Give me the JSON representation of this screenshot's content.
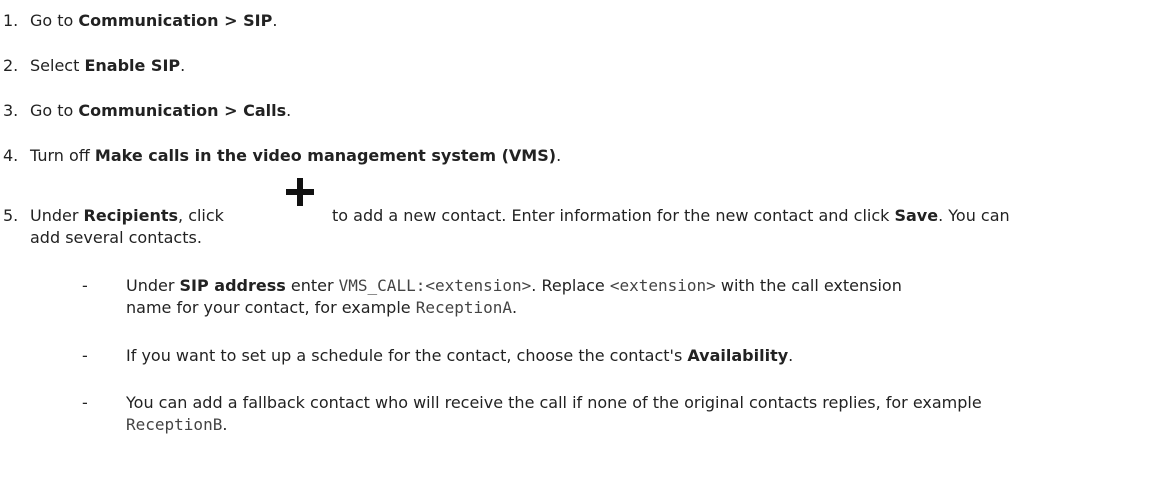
{
  "steps": [
    {
      "num": "1.",
      "pre": "Go to ",
      "b1": "Communication > SIP",
      "post": "."
    },
    {
      "num": "2.",
      "pre": "Select ",
      "b1": "Enable SIP",
      "post": "."
    },
    {
      "num": "3.",
      "pre": "Go to ",
      "b1": "Communication > Calls",
      "post": "."
    },
    {
      "num": "4.",
      "pre": "Turn off ",
      "b1": "Make calls in the video management system (VMS)",
      "post": "."
    },
    {
      "num": "5.",
      "pre": "Under ",
      "b1": "Recipients",
      "mid": ", click",
      "mid2": "to add a new contact. Enter information for the new contact and click ",
      "b2": "Save",
      "post": ". You can",
      "line2": "add several contacts."
    }
  ],
  "icon": "plus-icon",
  "bullets": [
    {
      "dash": "-",
      "pre": "Under ",
      "b1": "SIP address",
      "mid": " enter ",
      "code1": "VMS_CALL:<extension>",
      "mid2": ". Replace ",
      "code2": "<extension>",
      "post": " with the call extension",
      "line2pre": "name for your contact, for example ",
      "code3": "ReceptionA",
      "line2post": "."
    },
    {
      "dash": "-",
      "pre": "If you want to set up a schedule for the contact, choose the contact's ",
      "b1": "Availability",
      "post": "."
    },
    {
      "dash": "-",
      "pre": "You can add a fallback contact who will receive the call if none of the original contacts replies, for example",
      "code1": "ReceptionB",
      "post": "."
    }
  ]
}
